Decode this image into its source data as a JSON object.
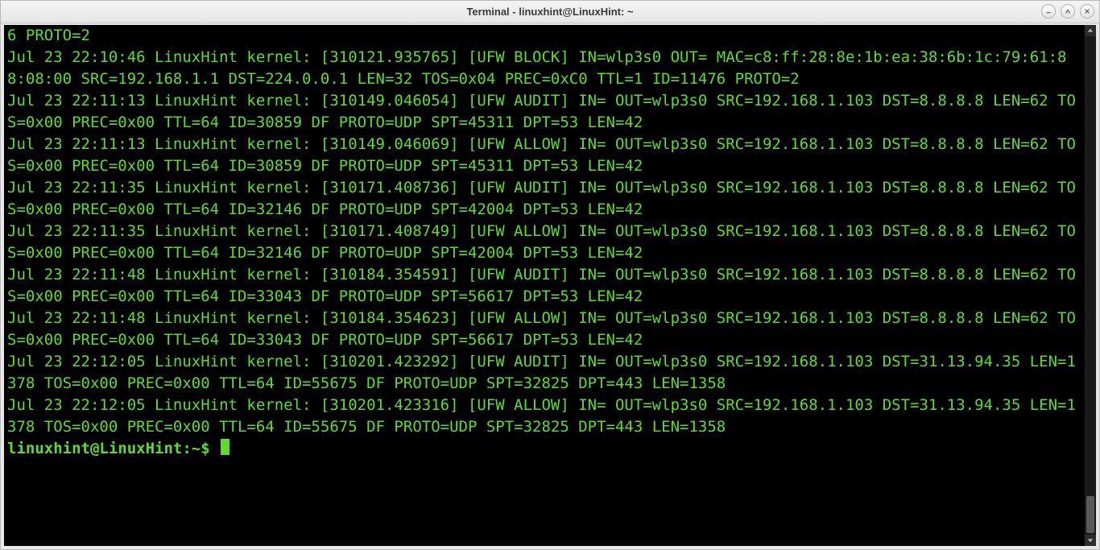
{
  "window": {
    "title": "Terminal - linuxhint@LinuxHint: ~"
  },
  "prompt": {
    "user_host": "linuxhint@LinuxHint",
    "colon": ":",
    "path": "~",
    "symbol": "$"
  },
  "log_lines": [
    "6 PROTO=2",
    "Jul 23 22:10:46 LinuxHint kernel: [310121.935765] [UFW BLOCK] IN=wlp3s0 OUT= MAC=c8:ff:28:8e:1b:ea:38:6b:1c:79:61:88:08:00 SRC=192.168.1.1 DST=224.0.0.1 LEN=32 TOS=0x04 PREC=0xC0 TTL=1 ID=11476 PROTO=2",
    "Jul 23 22:11:13 LinuxHint kernel: [310149.046054] [UFW AUDIT] IN= OUT=wlp3s0 SRC=192.168.1.103 DST=8.8.8.8 LEN=62 TOS=0x00 PREC=0x00 TTL=64 ID=30859 DF PROTO=UDP SPT=45311 DPT=53 LEN=42",
    "Jul 23 22:11:13 LinuxHint kernel: [310149.046069] [UFW ALLOW] IN= OUT=wlp3s0 SRC=192.168.1.103 DST=8.8.8.8 LEN=62 TOS=0x00 PREC=0x00 TTL=64 ID=30859 DF PROTO=UDP SPT=45311 DPT=53 LEN=42",
    "Jul 23 22:11:35 LinuxHint kernel: [310171.408736] [UFW AUDIT] IN= OUT=wlp3s0 SRC=192.168.1.103 DST=8.8.8.8 LEN=62 TOS=0x00 PREC=0x00 TTL=64 ID=32146 DF PROTO=UDP SPT=42004 DPT=53 LEN=42",
    "Jul 23 22:11:35 LinuxHint kernel: [310171.408749] [UFW ALLOW] IN= OUT=wlp3s0 SRC=192.168.1.103 DST=8.8.8.8 LEN=62 TOS=0x00 PREC=0x00 TTL=64 ID=32146 DF PROTO=UDP SPT=42004 DPT=53 LEN=42",
    "Jul 23 22:11:48 LinuxHint kernel: [310184.354591] [UFW AUDIT] IN= OUT=wlp3s0 SRC=192.168.1.103 DST=8.8.8.8 LEN=62 TOS=0x00 PREC=0x00 TTL=64 ID=33043 DF PROTO=UDP SPT=56617 DPT=53 LEN=42",
    "Jul 23 22:11:48 LinuxHint kernel: [310184.354623] [UFW ALLOW] IN= OUT=wlp3s0 SRC=192.168.1.103 DST=8.8.8.8 LEN=62 TOS=0x00 PREC=0x00 TTL=64 ID=33043 DF PROTO=UDP SPT=56617 DPT=53 LEN=42",
    "Jul 23 22:12:05 LinuxHint kernel: [310201.423292] [UFW AUDIT] IN= OUT=wlp3s0 SRC=192.168.1.103 DST=31.13.94.35 LEN=1378 TOS=0x00 PREC=0x00 TTL=64 ID=55675 DF PROTO=UDP SPT=32825 DPT=443 LEN=1358",
    "Jul 23 22:12:05 LinuxHint kernel: [310201.423316] [UFW ALLOW] IN= OUT=wlp3s0 SRC=192.168.1.103 DST=31.13.94.35 LEN=1378 TOS=0x00 PREC=0x00 TTL=64 ID=55675 DF PROTO=UDP SPT=32825 DPT=443 LEN=1358"
  ],
  "colors": {
    "term_bg": "#000000",
    "term_fg": "#5fdb2e"
  }
}
